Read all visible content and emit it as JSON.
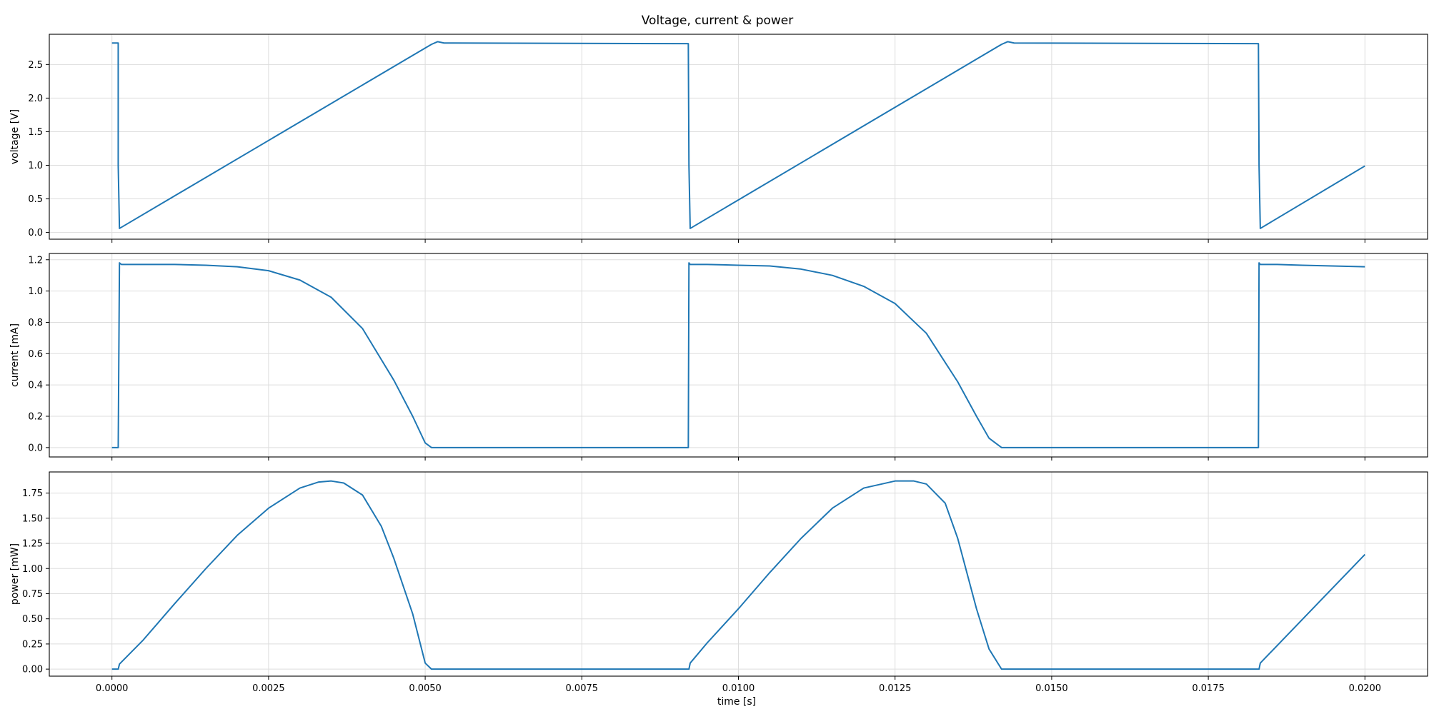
{
  "figure": {
    "title": "Voltage, current & power",
    "xlabel": "time [s]"
  },
  "chart_data": [
    {
      "type": "line",
      "title": "",
      "xlabel": "",
      "ylabel": "voltage [V]",
      "xlim": [
        -0.001,
        0.021
      ],
      "ylim": [
        -0.1,
        2.95
      ],
      "xticks": [
        "0.0000",
        "0.0025",
        "0.0050",
        "0.0075",
        "0.0100",
        "0.0125",
        "0.0150",
        "0.0175",
        "0.0200"
      ],
      "yticks": [
        "0.0",
        "0.5",
        "1.0",
        "1.5",
        "2.0",
        "2.5"
      ],
      "grid": true,
      "color": "#1f77b4",
      "x": [
        0.0,
        0.0001,
        0.0001,
        0.00012,
        0.0051,
        0.0052,
        0.0053,
        0.0092,
        0.00921,
        0.00923,
        0.0142,
        0.0143,
        0.0144,
        0.0183,
        0.01831,
        0.01833,
        0.02
      ],
      "y": [
        2.82,
        2.82,
        1.0,
        0.06,
        2.8,
        2.84,
        2.82,
        2.81,
        1.0,
        0.06,
        2.8,
        2.84,
        2.82,
        2.81,
        1.0,
        0.06,
        0.99
      ]
    },
    {
      "type": "line",
      "title": "",
      "xlabel": "",
      "ylabel": "current [mA]",
      "xlim": [
        -0.001,
        0.021
      ],
      "ylim": [
        -0.06,
        1.24
      ],
      "xticks": [
        "0.0000",
        "0.0025",
        "0.0050",
        "0.0075",
        "0.0100",
        "0.0125",
        "0.0150",
        "0.0175",
        "0.0200"
      ],
      "yticks": [
        "0.0",
        "0.2",
        "0.4",
        "0.6",
        "0.8",
        "1.0",
        "1.2"
      ],
      "grid": true,
      "color": "#1f77b4",
      "x": [
        0.0,
        0.0001,
        0.00012,
        0.00015,
        0.0005,
        0.001,
        0.0015,
        0.002,
        0.0025,
        0.003,
        0.0035,
        0.004,
        0.0045,
        0.0048,
        0.005,
        0.0051,
        0.0092,
        0.00921,
        0.00923,
        0.0095,
        0.01,
        0.0105,
        0.011,
        0.0115,
        0.012,
        0.0125,
        0.013,
        0.0135,
        0.0138,
        0.014,
        0.0142,
        0.0183,
        0.01831,
        0.01833,
        0.0186,
        0.019,
        0.02
      ],
      "y": [
        0.0,
        0.0,
        1.18,
        1.17,
        1.17,
        1.17,
        1.165,
        1.155,
        1.13,
        1.07,
        0.96,
        0.76,
        0.43,
        0.2,
        0.03,
        0.0,
        0.0,
        1.18,
        1.17,
        1.17,
        1.165,
        1.16,
        1.14,
        1.1,
        1.03,
        0.92,
        0.73,
        0.42,
        0.2,
        0.06,
        0.0,
        0.0,
        1.18,
        1.17,
        1.17,
        1.165,
        1.155
      ]
    },
    {
      "type": "line",
      "title": "",
      "xlabel": "time [s]",
      "ylabel": "power [mW]",
      "xlim": [
        -0.001,
        0.021
      ],
      "ylim": [
        -0.07,
        1.96
      ],
      "xticks": [
        "0.0000",
        "0.0025",
        "0.0050",
        "0.0075",
        "0.0100",
        "0.0125",
        "0.0150",
        "0.0175",
        "0.0200"
      ],
      "yticks": [
        "0.00",
        "0.25",
        "0.50",
        "0.75",
        "1.00",
        "1.25",
        "1.50",
        "1.75"
      ],
      "grid": true,
      "color": "#1f77b4",
      "x": [
        0.0,
        0.0001,
        0.00012,
        0.0005,
        0.001,
        0.0015,
        0.002,
        0.0025,
        0.003,
        0.0033,
        0.0035,
        0.0037,
        0.004,
        0.0043,
        0.0045,
        0.0048,
        0.005,
        0.0051,
        0.0092,
        0.00921,
        0.00923,
        0.0095,
        0.01,
        0.0105,
        0.011,
        0.0115,
        0.012,
        0.0125,
        0.0128,
        0.013,
        0.0133,
        0.0135,
        0.0138,
        0.014,
        0.0142,
        0.0183,
        0.01831,
        0.01833,
        0.02
      ],
      "y": [
        0.0,
        0.0,
        0.05,
        0.29,
        0.65,
        1.0,
        1.33,
        1.6,
        1.8,
        1.86,
        1.87,
        1.85,
        1.73,
        1.42,
        1.1,
        0.55,
        0.06,
        0.0,
        0.0,
        0.0,
        0.06,
        0.26,
        0.6,
        0.96,
        1.3,
        1.6,
        1.8,
        1.87,
        1.87,
        1.84,
        1.65,
        1.3,
        0.6,
        0.2,
        0.0,
        0.0,
        0.0,
        0.06,
        1.14
      ]
    }
  ]
}
